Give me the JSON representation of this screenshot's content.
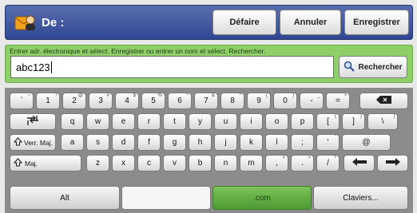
{
  "header": {
    "title": "De :",
    "buttons": {
      "undo": "Défaire",
      "cancel": "Annuler",
      "save": "Enregistrer"
    }
  },
  "input": {
    "instruction": "Entrer adr. électronique et sélect. Enregistrer ou entrer un nom et sélect. Rechercher.",
    "value": "abc123",
    "search_label": "Rechercher"
  },
  "keyboard": {
    "row1": [
      {
        "k": "`",
        "s": "~"
      },
      {
        "k": "1",
        "s": "!"
      },
      {
        "k": "2",
        "s": "@"
      },
      {
        "k": "3",
        "s": "#"
      },
      {
        "k": "4",
        "s": "$"
      },
      {
        "k": "5",
        "s": "%"
      },
      {
        "k": "6",
        "s": "^"
      },
      {
        "k": "7",
        "s": "&"
      },
      {
        "k": "8",
        "s": "*"
      },
      {
        "k": "9",
        "s": "("
      },
      {
        "k": "0",
        "s": ")"
      },
      {
        "k": "-",
        "s": "_"
      },
      {
        "k": "=",
        "s": "+"
      }
    ],
    "row2": [
      "q",
      "w",
      "e",
      "r",
      "t",
      "y",
      "u",
      "i",
      "o",
      "p",
      {
        "k": "[",
        "s": "{"
      },
      {
        "k": "]",
        "s": "}"
      },
      {
        "k": "\\",
        "s": "|"
      }
    ],
    "row3": [
      "a",
      "s",
      "d",
      "f",
      "g",
      "h",
      "j",
      "k",
      "l",
      {
        "k": ";",
        "s": ":"
      },
      {
        "k": "'",
        "s": "\""
      },
      "@"
    ],
    "row4": [
      "z",
      "x",
      "c",
      "v",
      "b",
      "n",
      "m",
      {
        "k": ",",
        "s": "<"
      },
      {
        "k": ".",
        "s": ">"
      },
      {
        "k": "/",
        "s": "?"
      }
    ],
    "caps_label": "Verr. Maj.",
    "shift_label": "Maj.",
    "alt_label": "Alt",
    "com_label": ".com",
    "keyboards_label": "Claviers..."
  }
}
